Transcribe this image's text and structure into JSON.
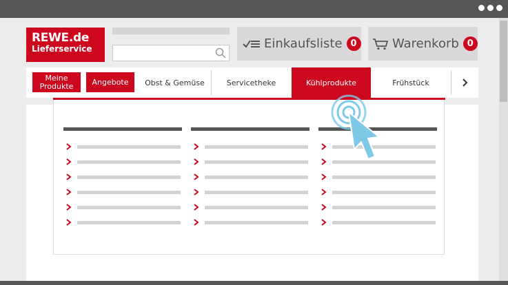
{
  "browser": {
    "menu_dots_icon": "three-dots-icon"
  },
  "logo": {
    "line1": "REWE.de",
    "line2": "Lieferservice",
    "brand_color": "#cc071e"
  },
  "search": {
    "value": "",
    "placeholder": "",
    "icon": "search-icon"
  },
  "header": {
    "shopping_list": {
      "label": "Einkaufsliste",
      "count": "0",
      "icon": "list-icon"
    },
    "cart": {
      "label": "Warenkorb",
      "count": "0",
      "icon": "cart-icon"
    }
  },
  "nav": {
    "items": [
      {
        "label": "Meine Produkte"
      },
      {
        "label": "Angebote"
      },
      {
        "label": "Obst & Gemüse"
      },
      {
        "label": "Servicetheke"
      },
      {
        "label": "Kühlprodukte"
      },
      {
        "label": "Frühstück"
      }
    ],
    "active": "Kühlprodukte",
    "next_icon": "chevron-right-icon"
  },
  "colors": {
    "accent": "#cc071e",
    "cursor": "#7ec8e8",
    "placeholder": "#d3d3d3",
    "heading": "#555555"
  }
}
